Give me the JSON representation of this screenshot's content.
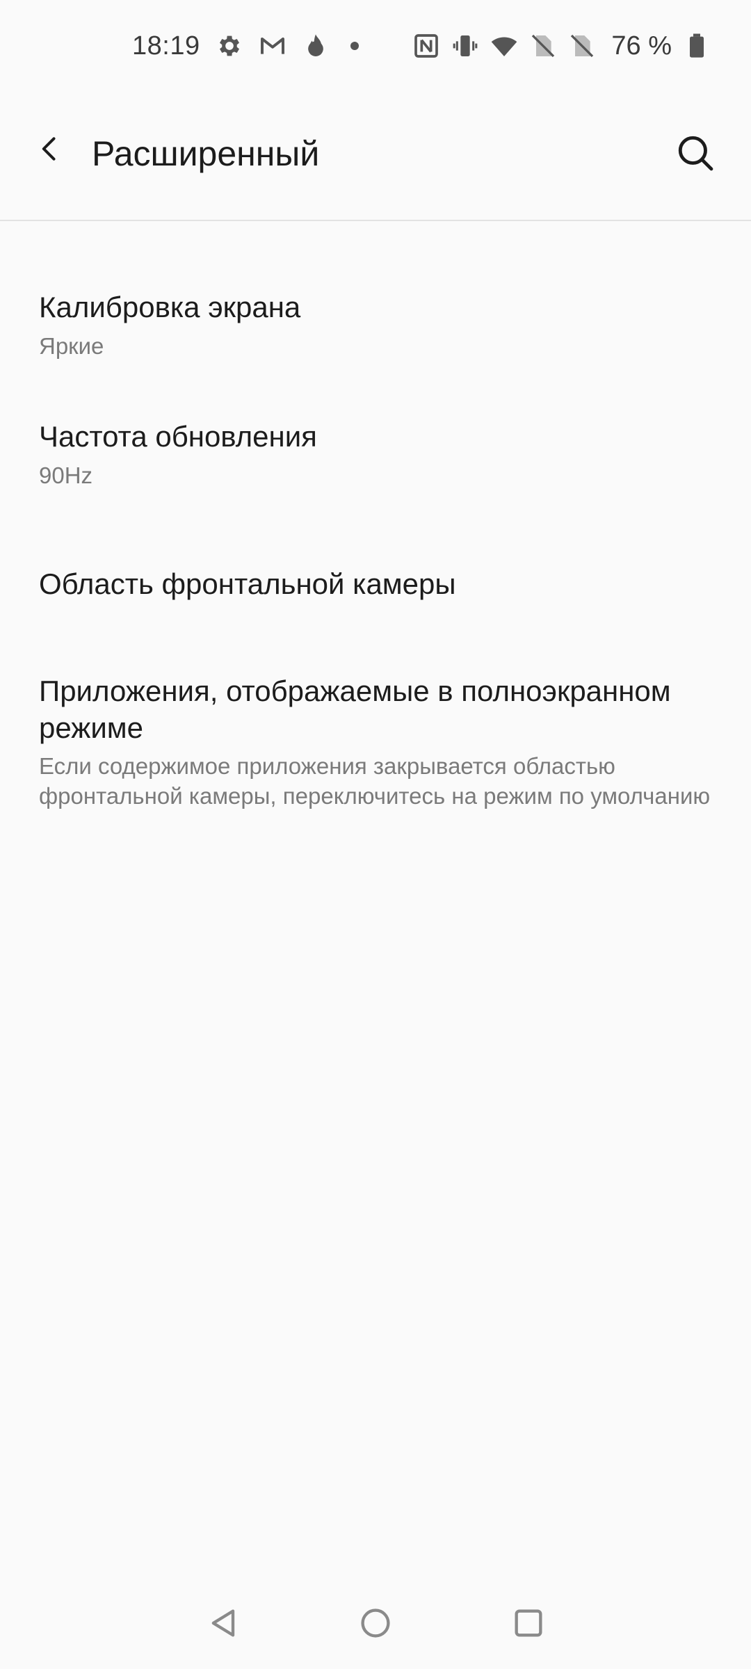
{
  "status_bar": {
    "time": "18:19",
    "battery_text": "76 %",
    "icons_left": [
      "gear-icon",
      "gmail-icon",
      "fire-icon",
      "notification-dot-icon"
    ],
    "icons_right": [
      "nfc-icon",
      "vibrate-icon",
      "wifi-icon",
      "no-sim-icon",
      "no-sim-icon",
      "battery-icon"
    ]
  },
  "app_bar": {
    "title": "Расширенный",
    "back_icon": "chevron-left-icon",
    "search_icon": "search-icon"
  },
  "settings": {
    "items": [
      {
        "title": "Калибровка экрана",
        "summary": "Яркие"
      },
      {
        "title": "Частота обновления",
        "summary": "90Hz"
      },
      {
        "title": "Область фронтальной камеры",
        "summary": ""
      },
      {
        "title": "Приложения, отображаемые в полноэкранном режиме",
        "summary": "Если содержимое приложения закрывается областью фронтальной камеры, переключитесь на режим по умолчанию"
      }
    ]
  },
  "nav_bar": {
    "icons": [
      "nav-back-icon",
      "nav-home-icon",
      "nav-recents-icon"
    ]
  },
  "colors": {
    "background": "#fafafa",
    "text_primary": "#1c1c1c",
    "text_secondary": "#7a7a7a",
    "divider": "#e2e2e2",
    "icon": "#555555"
  }
}
